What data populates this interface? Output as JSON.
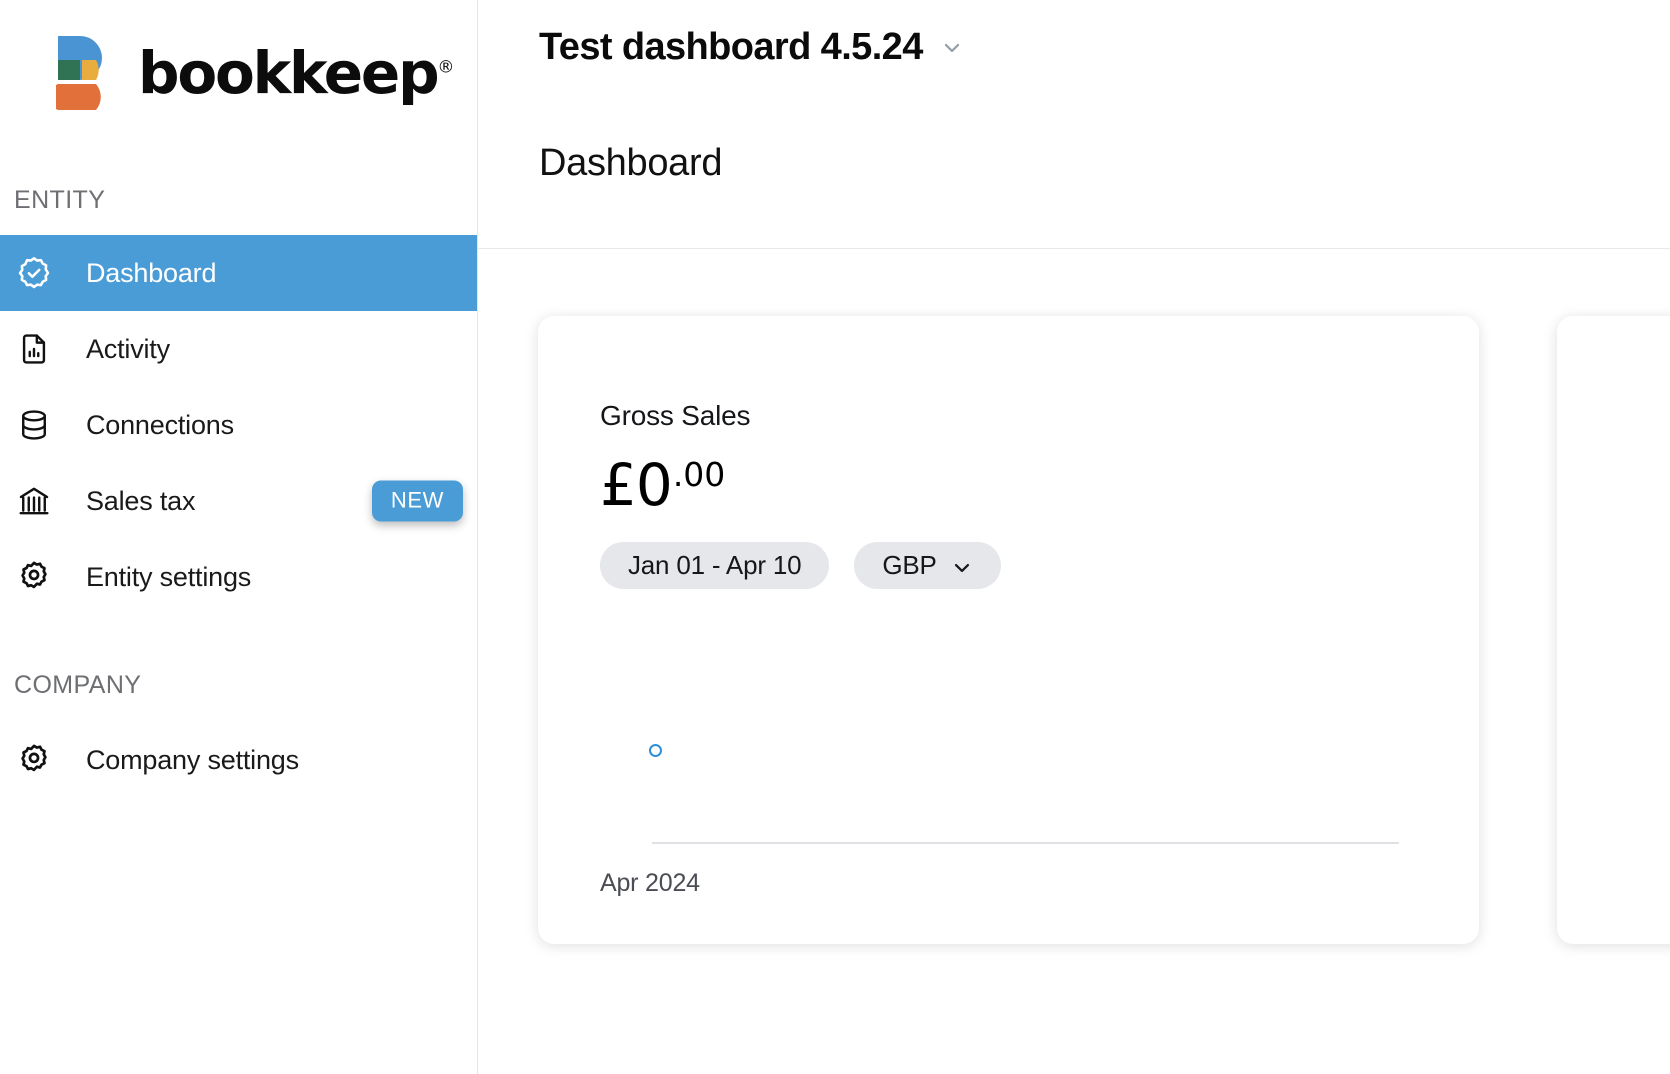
{
  "brand": {
    "name": "bookkeep",
    "registered_mark": "®",
    "logo_colors": {
      "blue": "#4a94d4",
      "green": "#2f7354",
      "yellow": "#e9ad3f",
      "orange": "#e2703a"
    }
  },
  "sidebar": {
    "sections": [
      {
        "label": "ENTITY",
        "items": [
          {
            "label": "Dashboard",
            "icon": "badge-check-icon",
            "active": true,
            "badge": null
          },
          {
            "label": "Activity",
            "icon": "document-chart-icon",
            "active": false,
            "badge": null
          },
          {
            "label": "Connections",
            "icon": "database-icon",
            "active": false,
            "badge": null
          },
          {
            "label": "Sales tax",
            "icon": "bank-icon",
            "active": false,
            "badge": "NEW"
          },
          {
            "label": "Entity settings",
            "icon": "gear-icon",
            "active": false,
            "badge": null
          }
        ]
      },
      {
        "label": "COMPANY",
        "items": [
          {
            "label": "Company settings",
            "icon": "gear-icon",
            "active": false,
            "badge": null
          }
        ]
      }
    ],
    "active_color": "#4a9cd7",
    "badge_color": "#4a9cd7"
  },
  "topbar": {
    "dashboard_name": "Test dashboard 4.5.24",
    "dashboard_chevron": "chevron-down-icon",
    "page_title": "Dashboard"
  },
  "cards": [
    {
      "title": "Gross Sales",
      "amount_whole": "£0",
      "amount_cents": ".00",
      "date_range_pill": "Jan 01 - Apr 10",
      "currency_pill": "GBP",
      "currency_chevron": "chevron-down-icon"
    }
  ],
  "chart_data": {
    "type": "scatter",
    "title": "Gross Sales",
    "x": [
      "Apr 2024"
    ],
    "values": [
      0
    ],
    "categories": [
      "Apr 2024"
    ],
    "series": [
      {
        "name": "Gross Sales",
        "values": [
          0
        ]
      }
    ],
    "xlabel": "",
    "ylabel": "",
    "tick_labels": [
      "Apr 2024"
    ],
    "grid": false,
    "legend": "none",
    "point_color": "#2e8fd8",
    "axis_color": "#dfe1e4",
    "currency": "GBP"
  }
}
